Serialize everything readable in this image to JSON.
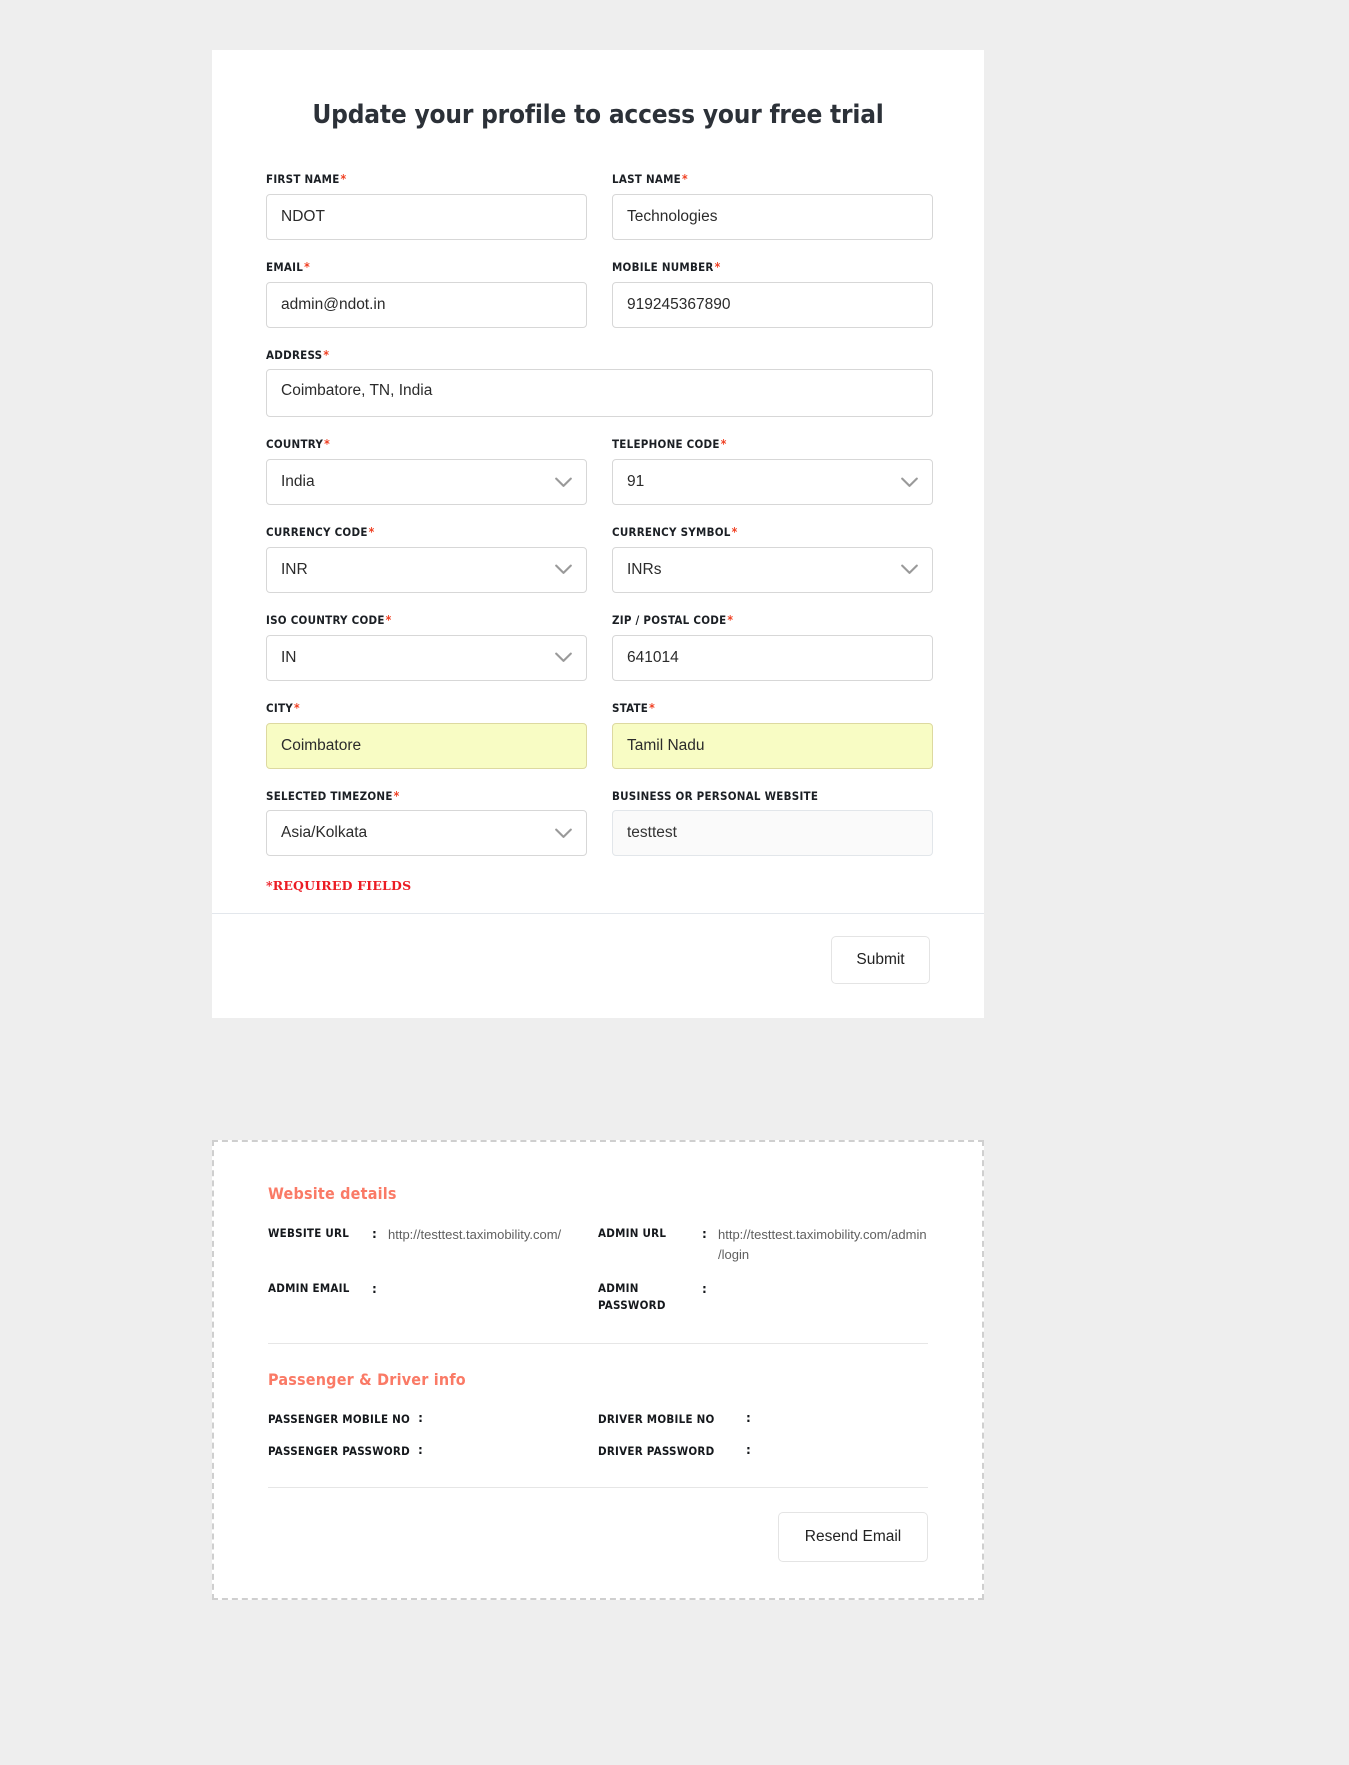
{
  "page": {
    "title": "Update your profile to access your free trial",
    "required_note": "*REQUIRED FIELDS",
    "accent_color": "#fa7a66",
    "required_color": "#f04124",
    "autofill_color": "#f8fcc4"
  },
  "form": {
    "first_name": {
      "label": "FIRST NAME",
      "required": "*",
      "value": "NDOT"
    },
    "last_name": {
      "label": "LAST NAME",
      "required": "*",
      "value": "Technologies"
    },
    "email": {
      "label": "EMAIL",
      "required": "*",
      "value": "admin@ndot.in"
    },
    "mobile_number": {
      "label": "MOBILE NUMBER",
      "required": "*",
      "value": "919245367890"
    },
    "address": {
      "label": "ADDRESS",
      "required": "*",
      "value": "Coimbatore, TN, India"
    },
    "country": {
      "label": "COUNTRY",
      "required": "*",
      "value": "India"
    },
    "telephone_code": {
      "label": "TELEPHONE CODE",
      "required": "*",
      "value": "91"
    },
    "currency_code": {
      "label": "CURRENCY CODE",
      "required": "*",
      "value": "INR"
    },
    "currency_symbol": {
      "label": "CURRENCY SYMBOL",
      "required": "*",
      "value": "INRs"
    },
    "iso_country_code": {
      "label": "ISO COUNTRY CODE",
      "required": "*",
      "value": "IN"
    },
    "zip_postal_code": {
      "label": "ZIP / POSTAL CODE",
      "required": "*",
      "value": "641014"
    },
    "city": {
      "label": "CITY",
      "required": "*",
      "value": "Coimbatore"
    },
    "state": {
      "label": "STATE",
      "required": "*",
      "value": "Tamil Nadu"
    },
    "selected_timezone": {
      "label": "SELECTED TIMEZONE",
      "required": "*",
      "value": "Asia/Kolkata"
    },
    "website": {
      "label": "BUSINESS OR PERSONAL WEBSITE",
      "required": "",
      "value": "testtest"
    }
  },
  "footer": {
    "submit_label": "Submit"
  },
  "details": {
    "website_section": {
      "heading": "Website details",
      "items": [
        {
          "key": "WEBSITE URL",
          "colon": ":",
          "value": "http://testtest.taximobility.com/"
        },
        {
          "key": "ADMIN URL",
          "colon": ":",
          "value": "http://testtest.taximobility.com/admin/login"
        },
        {
          "key": "ADMIN EMAIL",
          "colon": ":",
          "value": ""
        },
        {
          "key": "ADMIN PASSWORD",
          "colon": ":",
          "value": ""
        }
      ]
    },
    "passenger_driver_section": {
      "heading": "Passenger & Driver info",
      "items": [
        {
          "key": "PASSENGER MOBILE NO",
          "colon": ":"
        },
        {
          "key": "DRIVER MOBILE NO",
          "colon": ":"
        },
        {
          "key": "PASSENGER PASSWORD",
          "colon": ":"
        },
        {
          "key": "DRIVER PASSWORD",
          "colon": ":"
        }
      ]
    },
    "resend_label": "Resend Email"
  }
}
